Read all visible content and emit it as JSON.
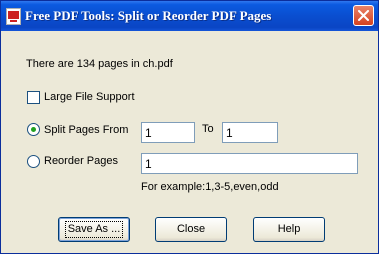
{
  "window": {
    "title": "Free PDF Tools: Split or Reorder PDF Pages"
  },
  "info": {
    "pages_text": "There are 134 pages in ch.pdf"
  },
  "options": {
    "large_file_label": "Large File Support",
    "large_file_checked": false,
    "split_label": "Split Pages From",
    "split_selected": true,
    "split_from": "1",
    "to_label": "To",
    "split_to": "1",
    "reorder_label": "Reorder Pages",
    "reorder_selected": false,
    "reorder_value": "1",
    "example_text": "For example:1,3-5,even,odd"
  },
  "buttons": {
    "save_as": "Save As ...",
    "close": "Close",
    "help": "Help"
  }
}
